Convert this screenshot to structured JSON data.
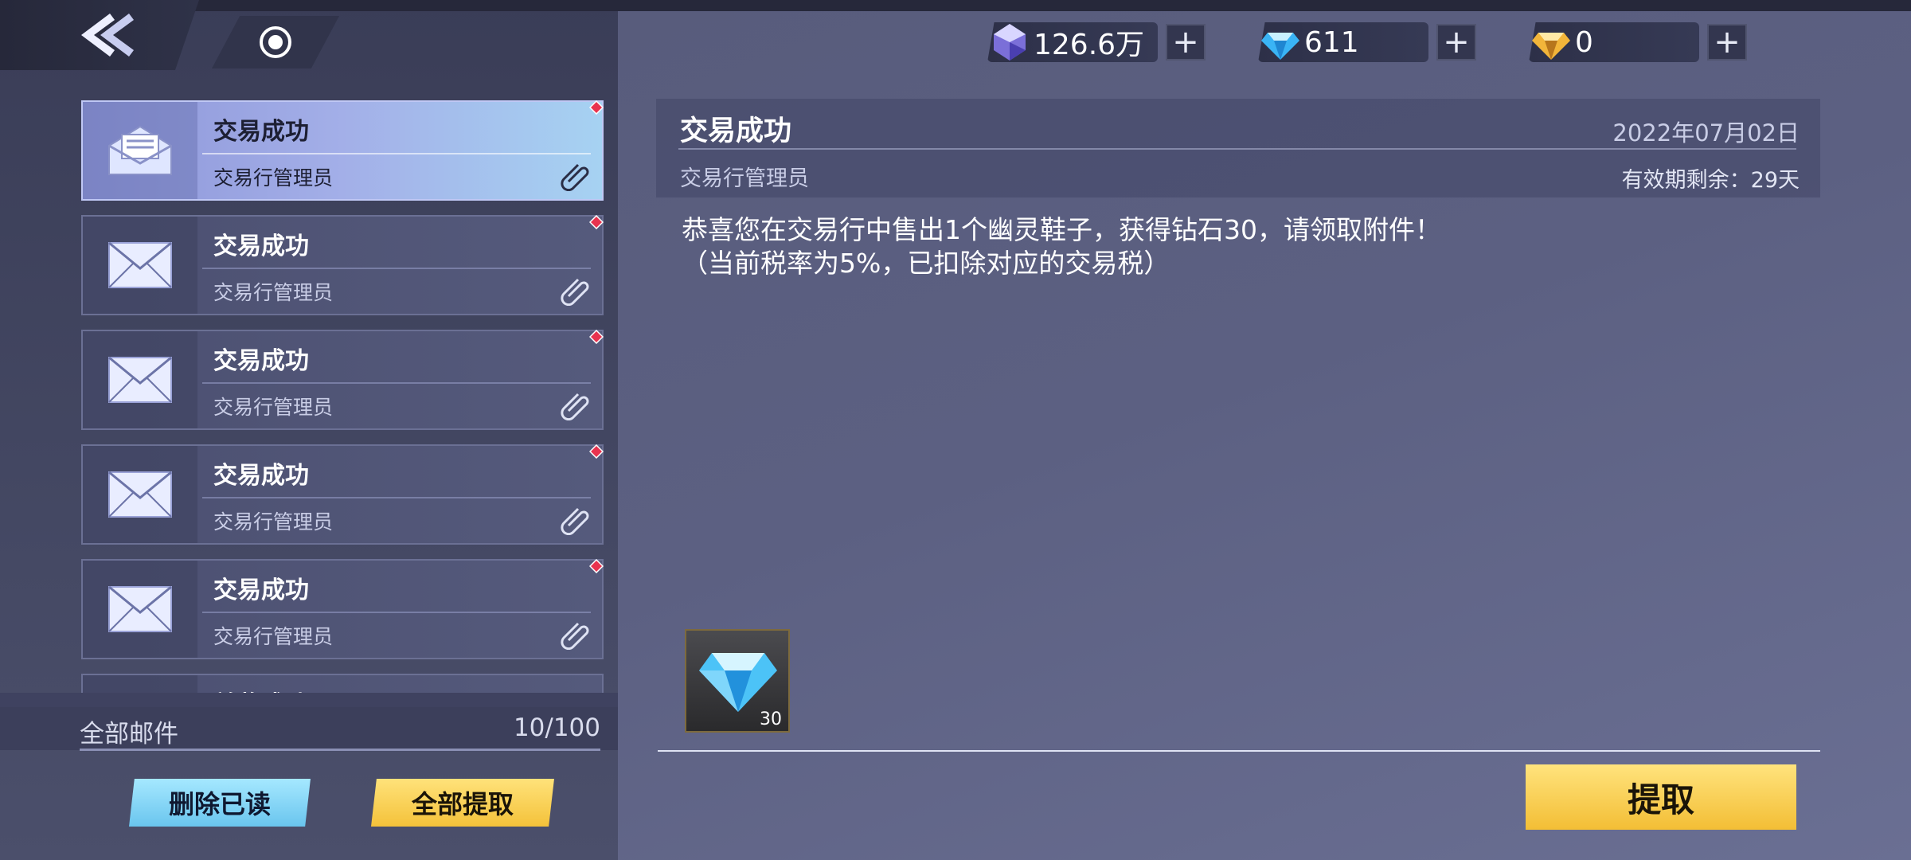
{
  "currencies": [
    {
      "icon": "crystal-icon",
      "amount": "126.6万",
      "plus": "+"
    },
    {
      "icon": "diamond-icon",
      "amount": "611",
      "plus": "+"
    },
    {
      "icon": "gold-gem-icon",
      "amount": "0",
      "plus": "+"
    }
  ],
  "mails": [
    {
      "title": "交易成功",
      "sender": "交易行管理员",
      "selected": true
    },
    {
      "title": "交易成功",
      "sender": "交易行管理员"
    },
    {
      "title": "交易成功",
      "sender": "交易行管理员"
    },
    {
      "title": "交易成功",
      "sender": "交易行管理员"
    },
    {
      "title": "交易成功",
      "sender": "交易行管理员"
    },
    {
      "title": "兑奖成功",
      "sender": ""
    }
  ],
  "footer": {
    "label": "全部邮件",
    "count": "10/100",
    "delete_read": "删除已读",
    "claim_all": "全部提取"
  },
  "detail": {
    "title": "交易成功",
    "date": "2022年07月02日",
    "sender": "交易行管理员",
    "expire": "有效期剩余：29天",
    "body_line1": "恭喜您在交易行中售出1个幽灵鞋子，获得钻石30，请领取附件！",
    "body_line2": "（当前税率为5%，已扣除对应的交易税）",
    "reward_qty": "30",
    "claim": "提取"
  },
  "colors": {
    "accent_yellow": "#f4c23a",
    "accent_blue": "#6ac5ee",
    "unread_dot": "#e8334f"
  }
}
